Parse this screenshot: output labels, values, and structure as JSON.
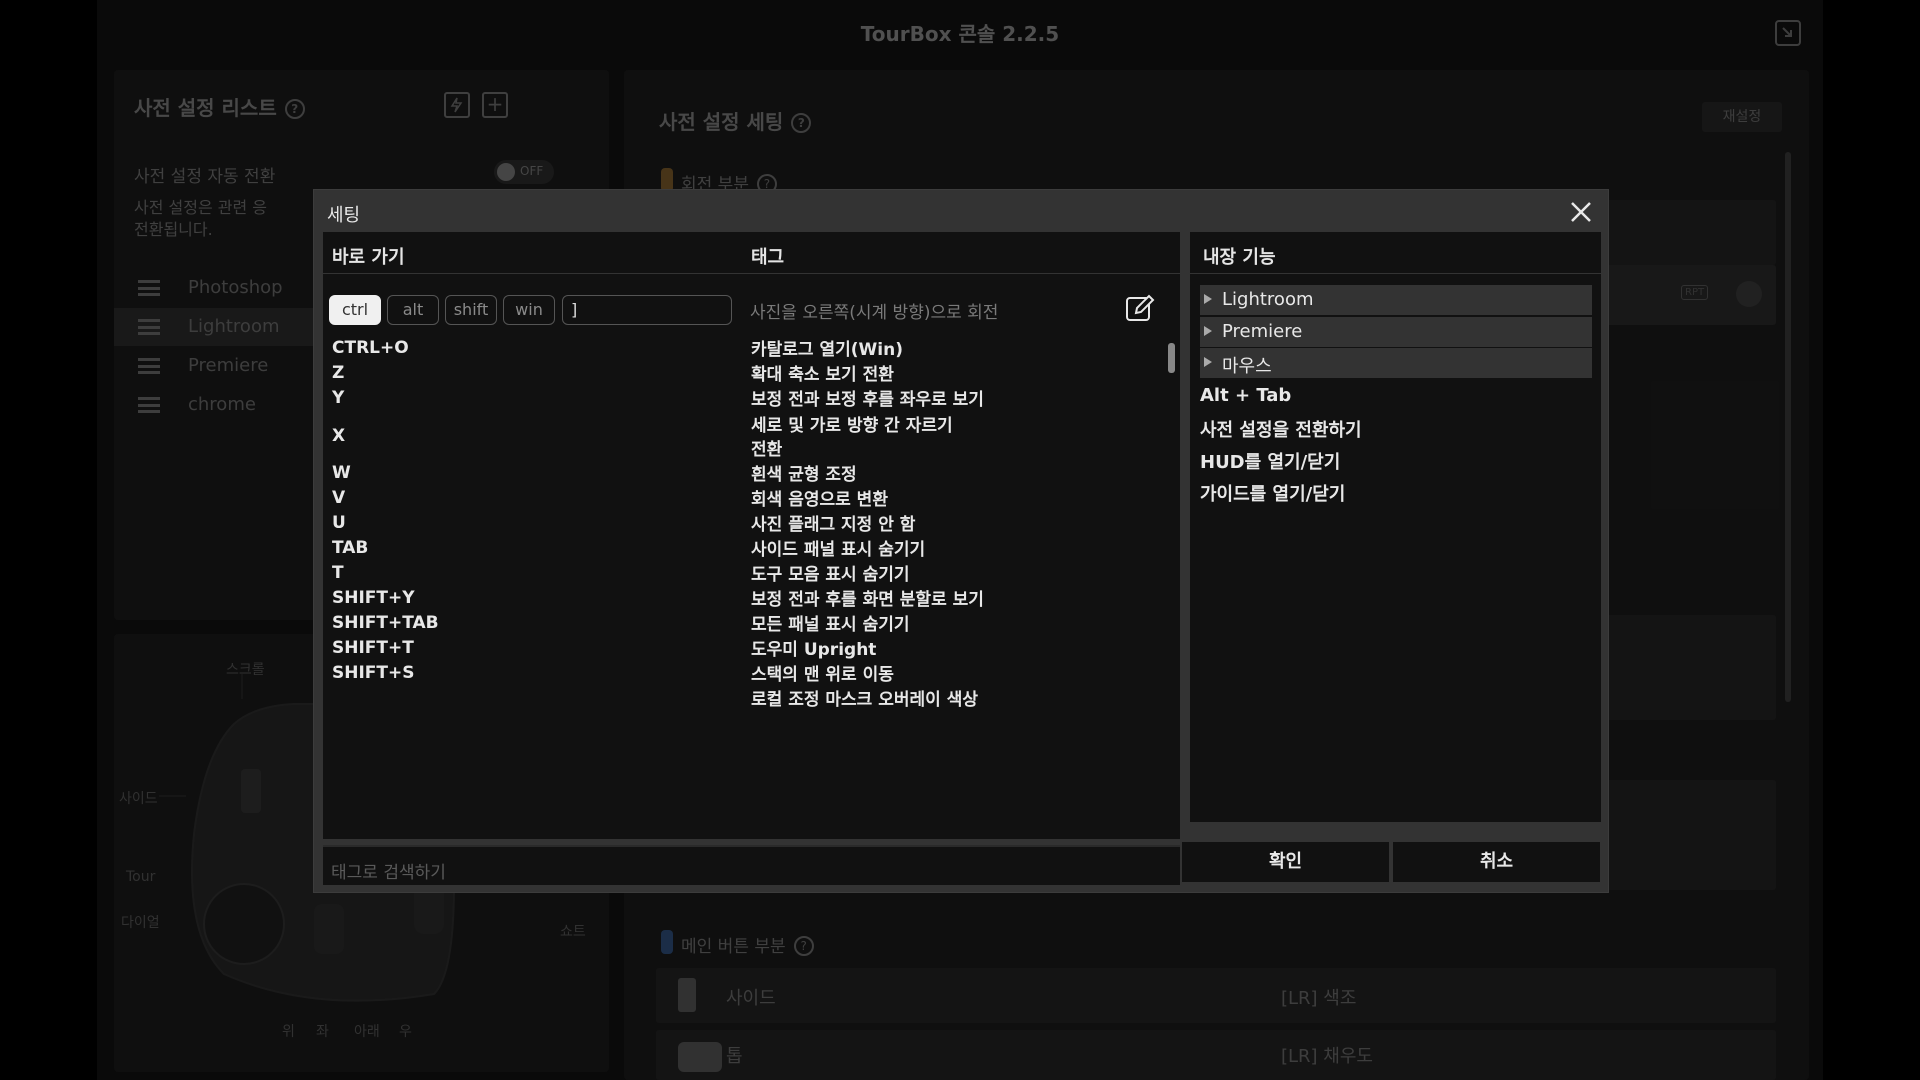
{
  "app": {
    "title": "TourBox 콘솔 2.2.5"
  },
  "preset_list": {
    "title": "사전 설정 리스트",
    "help": "?",
    "auto_switch_label": "사전 설정 자동 전환",
    "toggle_text": "OFF",
    "desc_line1": "사전 설정은 관련 응",
    "desc_line2": "전환됩니다.",
    "items": [
      {
        "label": "Photoshop"
      },
      {
        "label": "Lightroom"
      },
      {
        "label": "Premiere"
      },
      {
        "label": "chrome"
      }
    ]
  },
  "device_labels": {
    "scroll": "스크롤",
    "side": "사이드",
    "tour": "Tour",
    "dial": "다이얼",
    "short": "쇼트",
    "up": "위",
    "left": "좌",
    "down": "아래",
    "right": "우"
  },
  "preset_settings": {
    "title": "사전 설정 세팅",
    "help": "?",
    "reset": "재설정",
    "section_rotate": "회전 부분",
    "rpt_badge": "RPT",
    "section_main": "메인 버튼 부분",
    "main_rows": [
      {
        "name": "사이드",
        "value": "[LR] 색조"
      },
      {
        "name": "톱",
        "value": "[LR] 채우도"
      }
    ]
  },
  "dialog": {
    "title": "세팅",
    "shortcut_header": "바로 가기",
    "tag_header": "태그",
    "builtin_header": "내장 기능",
    "modifiers": [
      {
        "label": "ctrl",
        "active": true
      },
      {
        "label": "alt",
        "active": false
      },
      {
        "label": "shift",
        "active": false
      },
      {
        "label": "win",
        "active": false
      }
    ],
    "key_value": "]",
    "tag_value": "사진을 오른쪽(시계 방향)으로 회전",
    "shortcuts": [
      {
        "key": "CTRL+O",
        "tag": "카탈로그 열기(Win)"
      },
      {
        "key": "Z",
        "tag": "확대 축소 보기 전환"
      },
      {
        "key": "Y",
        "tag": "보정 전과 보정 후를 좌우로 보기"
      },
      {
        "key": "X",
        "tag": "세로 및 가로 방향 간 자르기 전환"
      },
      {
        "key": "W",
        "tag": "흰색 균형 조정"
      },
      {
        "key": "V",
        "tag": "회색 음영으로 변환"
      },
      {
        "key": "U",
        "tag": "사진 플래그 지정 안 함"
      },
      {
        "key": "TAB",
        "tag": "사이드 패널 표시 숨기기"
      },
      {
        "key": "T",
        "tag": "도구 모음 표시 숨기기"
      },
      {
        "key": "SHIFT+Y",
        "tag": "보정 전과 후를 화면 분할로 보기"
      },
      {
        "key": "SHIFT+TAB",
        "tag": "모든 패널 표시 숨기기"
      },
      {
        "key": "SHIFT+T",
        "tag": "도우미 Upright"
      },
      {
        "key": "SHIFT+S",
        "tag": "스택의 맨 위로 이동"
      },
      {
        "key": "",
        "tag": "로컬 조정 마스크 오버레이 색상"
      }
    ],
    "search_placeholder": "태그로 검색하기",
    "builtin_groups": [
      {
        "label": "Lightroom"
      },
      {
        "label": "Premiere"
      },
      {
        "label": "마우스"
      }
    ],
    "builtin_items": [
      {
        "label": "Alt + Tab"
      },
      {
        "label": "사전 설정을 전환하기"
      },
      {
        "label": "HUD를 열기/닫기"
      },
      {
        "label": "가이드를 열기/닫기"
      }
    ],
    "confirm": "확인",
    "cancel": "취소"
  },
  "colors": {
    "accent_rotate": "#b07a2c",
    "accent_main": "#3f6fae"
  }
}
